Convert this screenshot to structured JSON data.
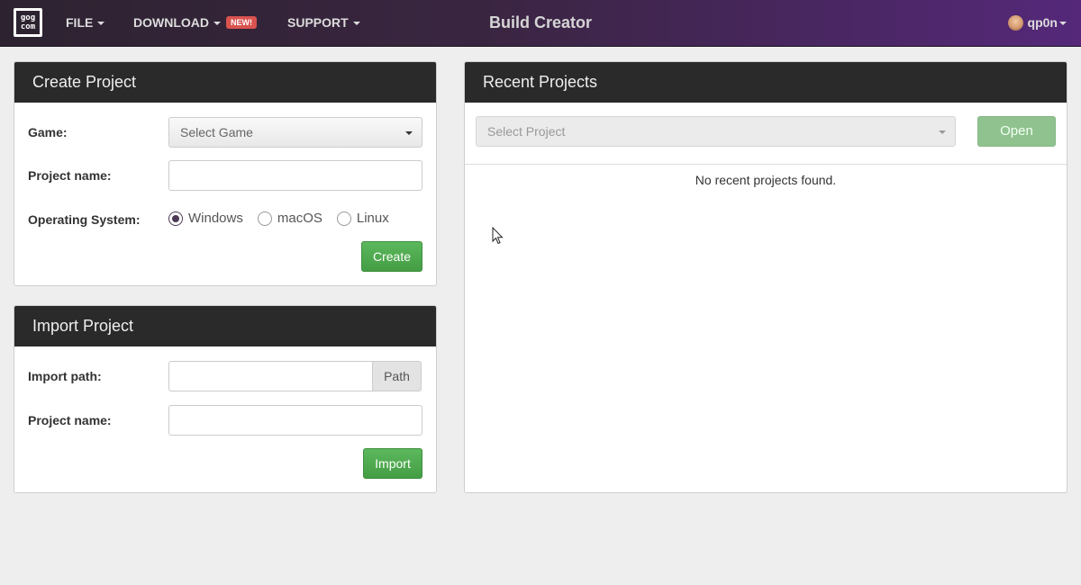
{
  "nav": {
    "logo_line1": "gog",
    "logo_line2": "com",
    "file_label": "FILE",
    "download_label": "DOWNLOAD",
    "download_badge": "NEW!",
    "support_label": "SUPPORT",
    "app_title": "Build Creator",
    "username": "qp0n"
  },
  "create_project": {
    "title": "Create Project",
    "game_label": "Game:",
    "game_select_value": "Select Game",
    "name_label": "Project name:",
    "name_value": "",
    "os_label": "Operating System:",
    "os_options": [
      {
        "label": "Windows",
        "checked": true
      },
      {
        "label": "macOS",
        "checked": false
      },
      {
        "label": "Linux",
        "checked": false
      }
    ],
    "create_button": "Create"
  },
  "import_project": {
    "title": "Import Project",
    "path_label": "Import path:",
    "path_value": "",
    "path_button": "Path",
    "name_label": "Project name:",
    "name_value": "",
    "import_button": "Import"
  },
  "recent_projects": {
    "title": "Recent Projects",
    "select_value": "Select Project",
    "open_button": "Open",
    "empty_message": "No recent projects found."
  },
  "colors": {
    "nav_gradient_start": "#2d2330",
    "nav_gradient_end": "#55287a",
    "panel_heading": "#2a2a2a",
    "button_green": "#5cb85c",
    "badge_red": "#d9534f"
  }
}
